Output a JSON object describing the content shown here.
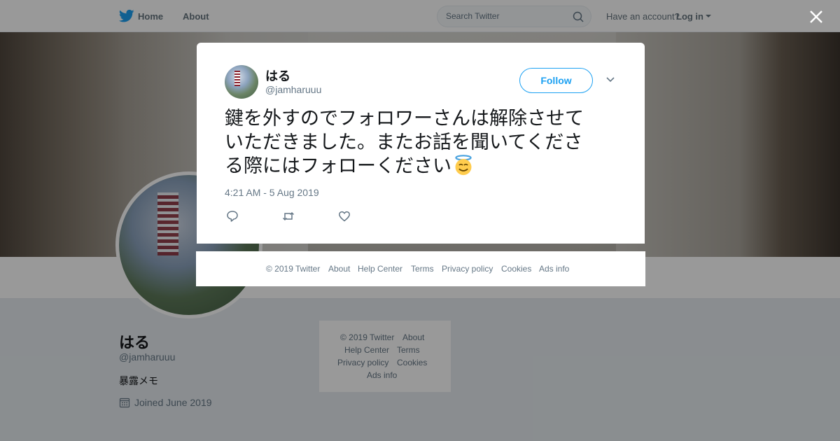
{
  "nav": {
    "home_label": "Home",
    "about_label": "About",
    "search_placeholder": "Search Twitter",
    "have_account": "Have an account?",
    "login_label": "Log in"
  },
  "profile": {
    "name": "はる",
    "handle": "@jamharuuu",
    "bio": "暴露メモ",
    "joined": "Joined June 2019"
  },
  "side_footer": {
    "copyright": "© 2019 Twitter",
    "about": "About",
    "help_center": "Help Center",
    "terms": "Terms",
    "privacy": "Privacy policy",
    "cookies": "Cookies",
    "ads_info": "Ads info"
  },
  "tweet": {
    "author_name": "はる",
    "author_handle": "@jamharuuu",
    "follow_label": "Follow",
    "line1": "鍵を外すのでフォロワーさんは解除させて",
    "line2": "いただきました。またお話を聞いてくださ",
    "line3": "る際にはフォローください",
    "emoji": "smiling-face-with-halo",
    "timestamp": "4:21 AM - 5 Aug 2019"
  },
  "modal_footer": {
    "copyright": "© 2019 Twitter",
    "about": "About",
    "help_center": "Help Center",
    "terms": "Terms",
    "privacy": "Privacy policy",
    "cookies": "Cookies",
    "ads_info": "Ads info"
  },
  "colors": {
    "brand_blue": "#1da1f2",
    "secondary_text": "#657786",
    "overlay": "rgba(0,0,0,0.4)"
  }
}
